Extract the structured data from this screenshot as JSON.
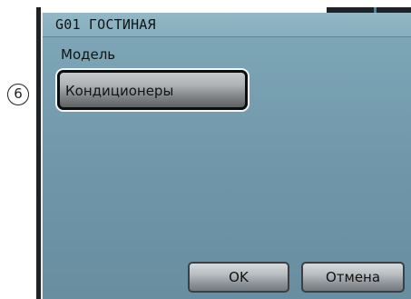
{
  "window": {
    "title": "G01 ГОСТИНАЯ"
  },
  "section": {
    "label": "Модель"
  },
  "model_option": {
    "label": "Кондиционеры"
  },
  "callout": {
    "number": "6"
  },
  "buttons": {
    "ok_label": "OK",
    "cancel_label": "Отмена"
  },
  "colors": {
    "screen_background": "#7fa8b9",
    "bezel": "#1e2226",
    "button_face": "#b9bdc0"
  }
}
